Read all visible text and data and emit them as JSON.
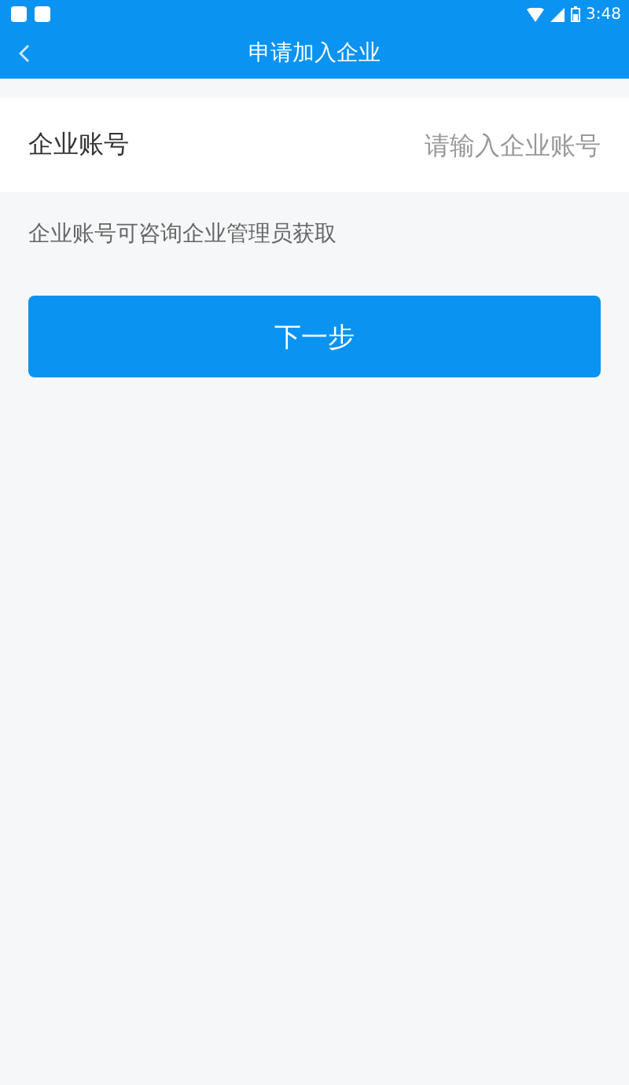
{
  "status_bar": {
    "time": "3:48"
  },
  "nav": {
    "title": "申请加入企业"
  },
  "field": {
    "label": "企业账号",
    "placeholder": "请输入企业账号"
  },
  "hint": "企业账号可咨询企业管理员获取",
  "button": {
    "label": "下一步"
  }
}
